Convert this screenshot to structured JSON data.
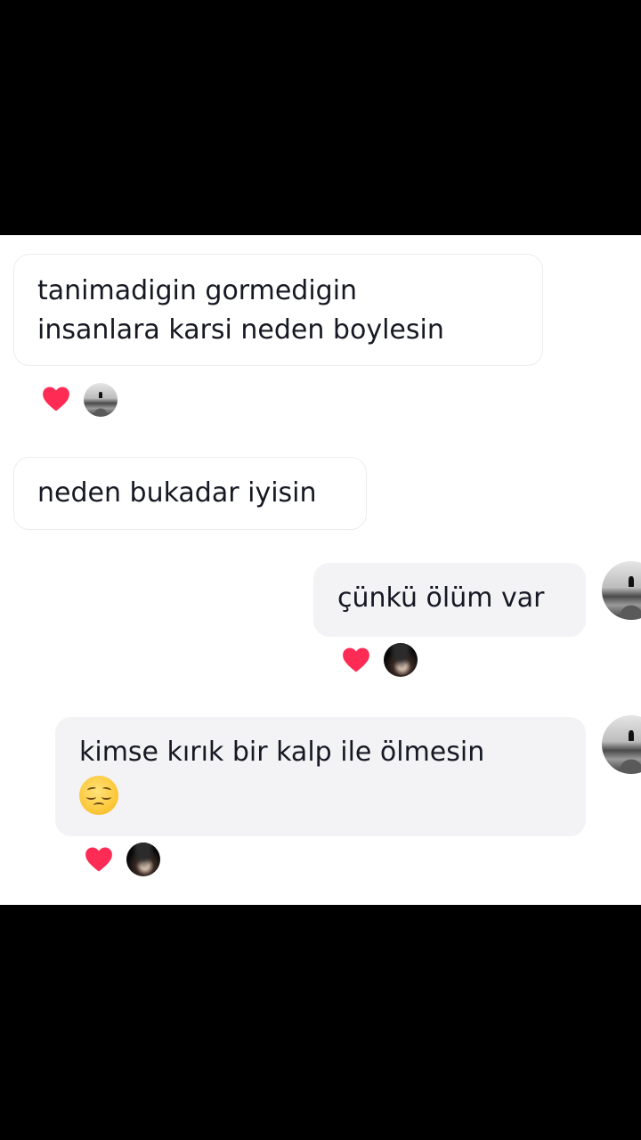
{
  "colors": {
    "heart": "#fe2c55",
    "incoming_bubble": "#ffffff",
    "outgoing_bubble": "#f3f3f5",
    "text": "#161823",
    "background": "#ffffff"
  },
  "messages": [
    {
      "direction": "incoming",
      "text": "tanimadigin gormedigin\ninsanlara karsi neden boylesin",
      "reactions": [
        "heart-icon",
        "avatar-grey"
      ]
    },
    {
      "direction": "incoming",
      "text": "neden bukadar iyisin",
      "reactions": []
    },
    {
      "direction": "outgoing",
      "text": "çünkü ölüm var",
      "reactions": [
        "heart-icon",
        "avatar-dark"
      ]
    },
    {
      "direction": "outgoing",
      "text": "kimse kırık bir kalp ile ölmesin",
      "emoji": "pensive-face-emoji",
      "reactions": [
        "heart-icon",
        "avatar-dark"
      ]
    }
  ]
}
